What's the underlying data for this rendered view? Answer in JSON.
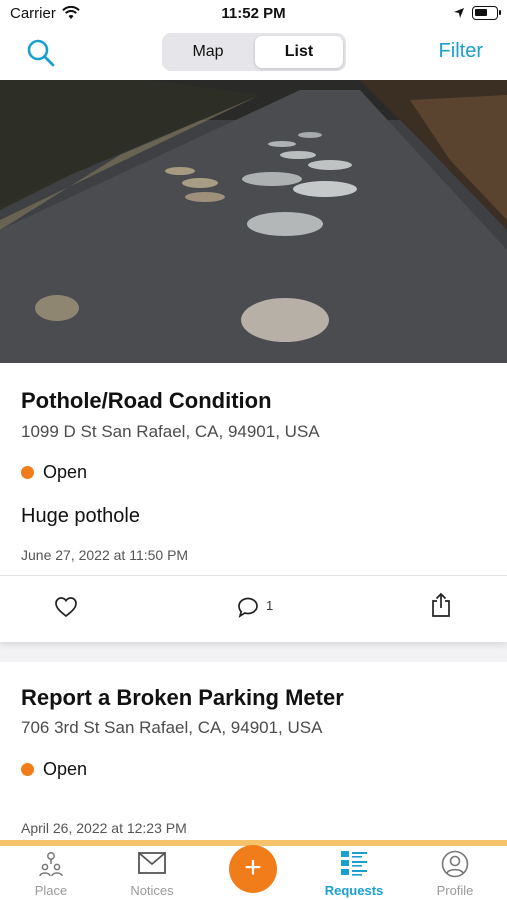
{
  "status_bar": {
    "carrier": "Carrier",
    "time": "11:52 PM"
  },
  "nav": {
    "search_icon": "search-icon",
    "segments": [
      "Map",
      "List"
    ],
    "selected_segment": "List",
    "filter_label": "Filter"
  },
  "requests": [
    {
      "title": "Pothole/Road Condition",
      "address": "1099 D St San Rafael, CA, 94901, USA",
      "status": "Open",
      "description": "Huge pothole",
      "date": "June 27, 2022 at 11:50 PM",
      "comment_count": "1",
      "photo": "road-with-potholes"
    },
    {
      "title": "Report a Broken Parking Meter",
      "address": "706 3rd St San Rafael, CA, 94901, USA",
      "status": "Open",
      "date": "April 26, 2022 at 12:23 PM"
    }
  ],
  "tab_bar": {
    "items": [
      {
        "label": "Place",
        "icon": "place-icon"
      },
      {
        "label": "Notices",
        "icon": "mail-icon"
      },
      {
        "label": "Requests",
        "icon": "list-icon",
        "active": true
      },
      {
        "label": "Profile",
        "icon": "profile-icon"
      }
    ],
    "add_label": "+"
  },
  "colors": {
    "accent": "#1aa0cf",
    "status_open": "#f07d1a",
    "add_button": "#f07d1a"
  }
}
